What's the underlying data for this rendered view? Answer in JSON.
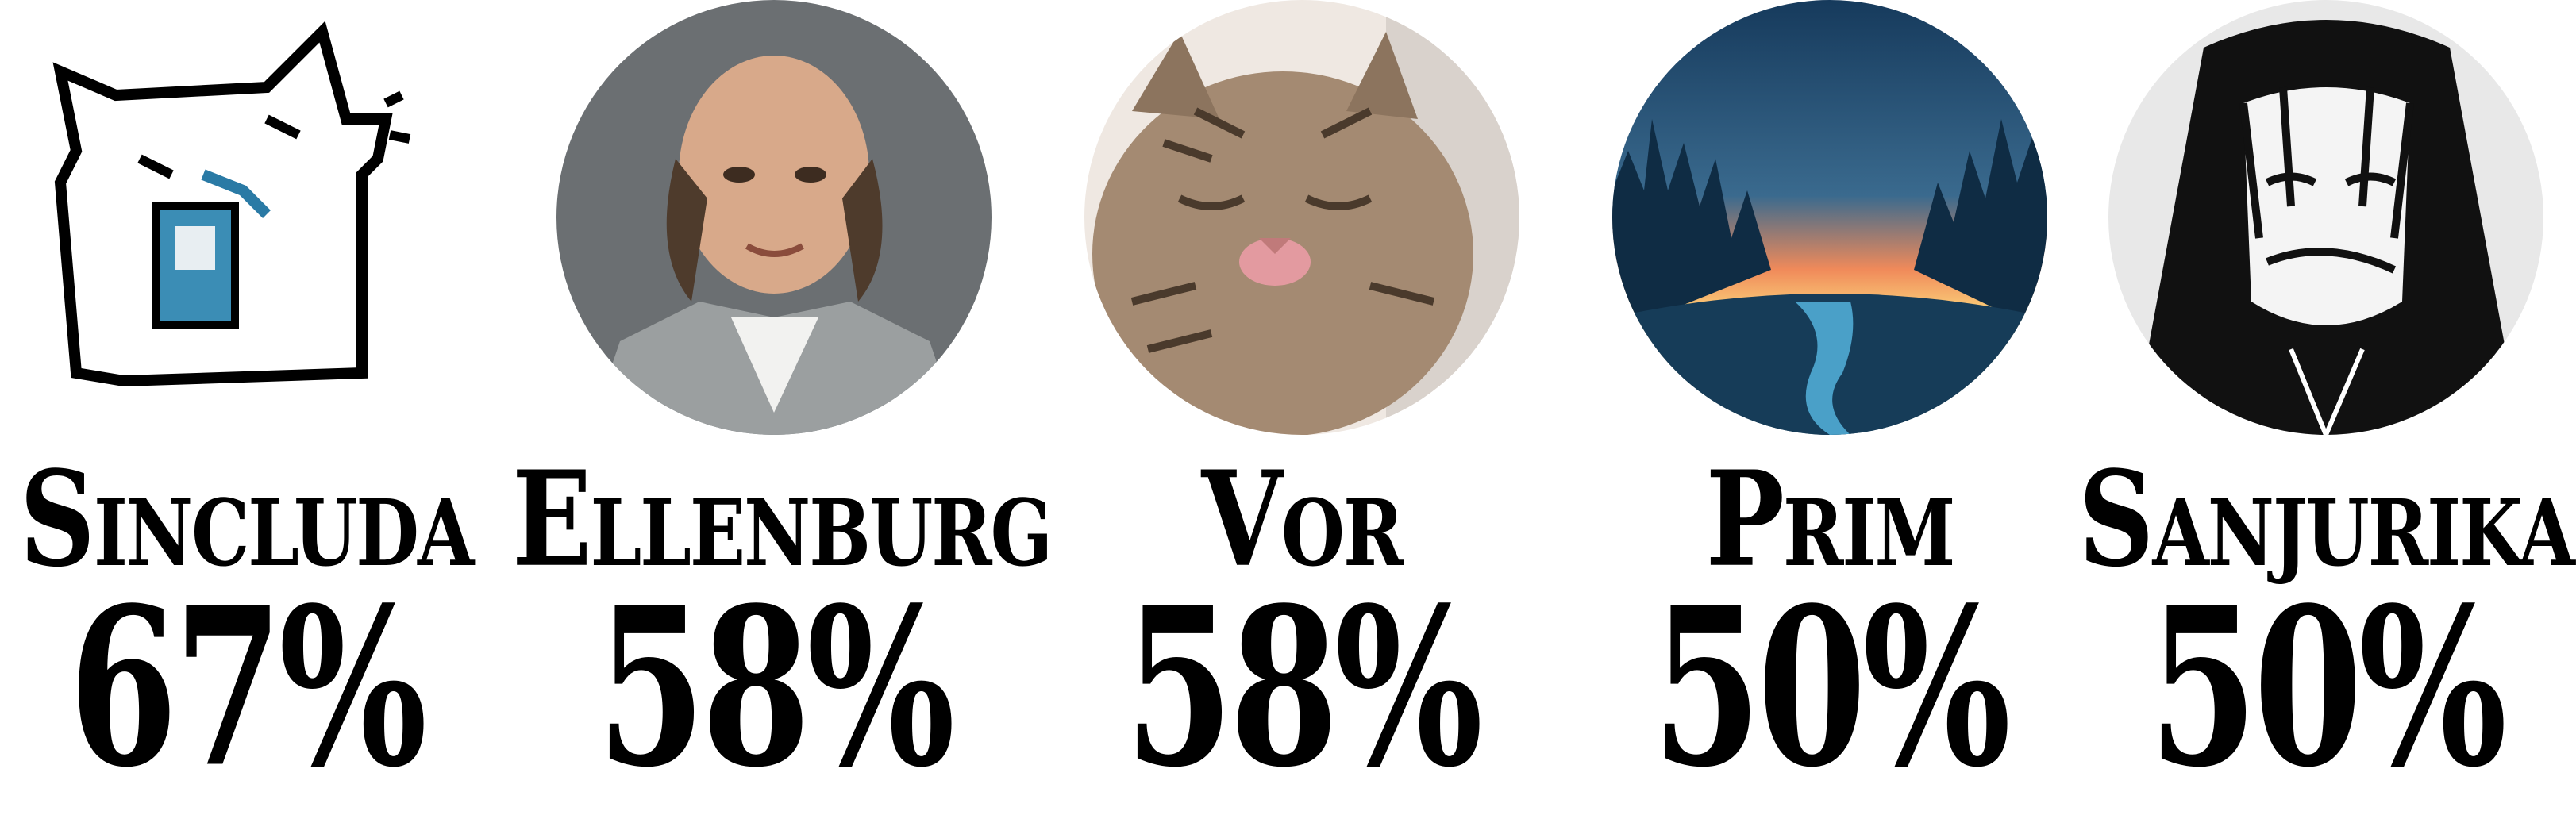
{
  "users": [
    {
      "name": "Sincluda",
      "percent": "67%",
      "avatar": "pixel-cat-avatar"
    },
    {
      "name": "Ellenburg",
      "percent": "58%",
      "avatar": "portrait-avatar"
    },
    {
      "name": "Vor",
      "percent": "58%",
      "avatar": "tabby-cat-avatar"
    },
    {
      "name": "Prim",
      "percent": "50%",
      "avatar": "forest-sunset-avatar"
    },
    {
      "name": "Sanjurika",
      "percent": "50%",
      "avatar": "anime-girl-avatar"
    }
  ]
}
